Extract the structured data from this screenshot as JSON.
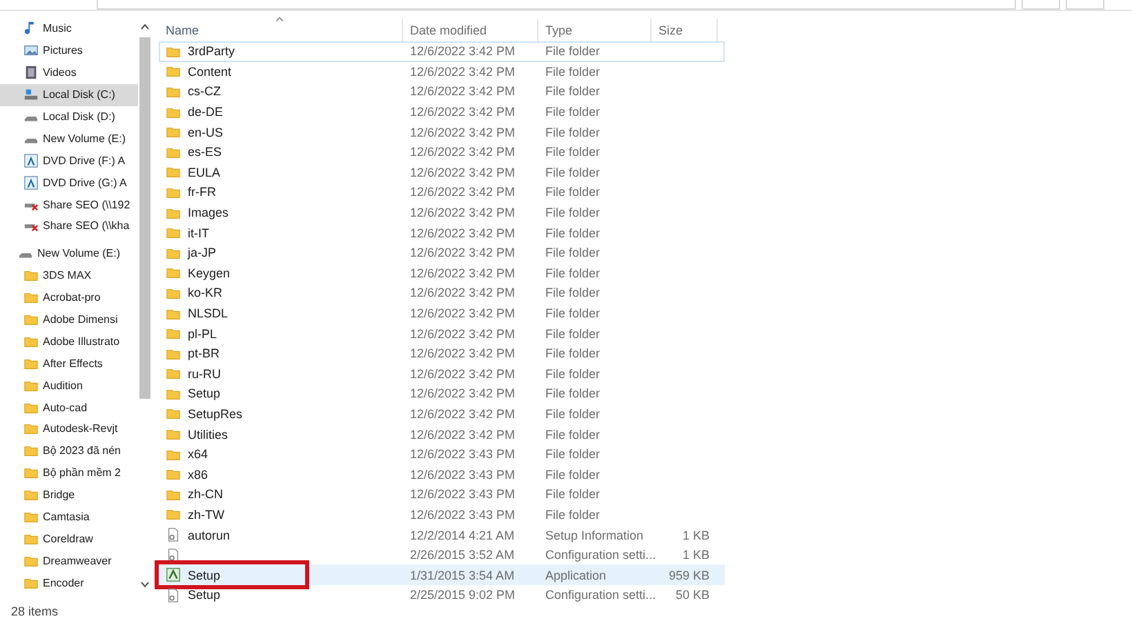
{
  "sidebar": {
    "items": [
      {
        "label": "Music",
        "kind": "music",
        "selected": false
      },
      {
        "label": "Pictures",
        "kind": "pictures",
        "selected": false
      },
      {
        "label": "Videos",
        "kind": "videos",
        "selected": false
      },
      {
        "label": "Local Disk (C:)",
        "kind": "system-drive",
        "selected": true
      },
      {
        "label": "Local Disk (D:)",
        "kind": "drive",
        "selected": false
      },
      {
        "label": "New Volume (E:)",
        "kind": "drive",
        "selected": false
      },
      {
        "label": "DVD Drive (F:) A",
        "kind": "dvd",
        "selected": false
      },
      {
        "label": "DVD Drive (G:) A",
        "kind": "dvd",
        "selected": false
      },
      {
        "label": "Share SEO (\\\\192",
        "kind": "network",
        "selected": false
      },
      {
        "label": "Share SEO (\\\\kha",
        "kind": "network",
        "selected": false
      },
      {
        "label": "New Volume (E:)",
        "kind": "drive-root",
        "selected": false,
        "children": [
          {
            "label": "3DS MAX",
            "kind": "folder",
            "selected": false
          },
          {
            "label": "Acrobat-pro",
            "kind": "folder",
            "selected": false
          },
          {
            "label": "Adobe Dimensi",
            "kind": "folder",
            "selected": false
          },
          {
            "label": "Adobe Illustrato",
            "kind": "folder",
            "selected": false
          },
          {
            "label": "After Effects",
            "kind": "folder",
            "selected": false
          },
          {
            "label": "Audition",
            "kind": "folder",
            "selected": false
          },
          {
            "label": "Auto-cad",
            "kind": "folder",
            "selected": false
          },
          {
            "label": "Autodesk-Revjt",
            "kind": "folder",
            "selected": false
          },
          {
            "label": "Bộ 2023 đã nén",
            "kind": "folder",
            "selected": false
          },
          {
            "label": "Bộ phần mềm 2",
            "kind": "folder",
            "selected": false
          },
          {
            "label": "Bridge",
            "kind": "folder",
            "selected": false
          },
          {
            "label": "Camtasia",
            "kind": "folder",
            "selected": false
          },
          {
            "label": "Coreldraw",
            "kind": "folder",
            "selected": false
          },
          {
            "label": "Dreamweaver",
            "kind": "folder",
            "selected": false
          },
          {
            "label": "Encoder",
            "kind": "folder",
            "selected": false
          }
        ]
      }
    ]
  },
  "table": {
    "columns": [
      "Name",
      "Date modified",
      "Type",
      "Size"
    ],
    "rows": [
      {
        "name": "3rdParty",
        "date": "12/6/2022 3:42 PM",
        "type": "File folder",
        "kind": "folder",
        "selected": false
      },
      {
        "name": "Content",
        "date": "12/6/2022 3:42 PM",
        "type": "File folder",
        "kind": "folder",
        "selected": false
      },
      {
        "name": "cs-CZ",
        "date": "12/6/2022 3:42 PM",
        "type": "File folder",
        "kind": "folder",
        "selected": false
      },
      {
        "name": "de-DE",
        "date": "12/6/2022 3:42 PM",
        "type": "File folder",
        "kind": "folder",
        "selected": false
      },
      {
        "name": "en-US",
        "date": "12/6/2022 3:42 PM",
        "type": "File folder",
        "kind": "folder",
        "selected": false
      },
      {
        "name": "es-ES",
        "date": "12/6/2022 3:42 PM",
        "type": "File folder",
        "kind": "folder",
        "selected": false
      },
      {
        "name": "EULA",
        "date": "12/6/2022 3:42 PM",
        "type": "File folder",
        "kind": "folder",
        "selected": false
      },
      {
        "name": "fr-FR",
        "date": "12/6/2022 3:42 PM",
        "type": "File folder",
        "kind": "folder",
        "selected": false
      },
      {
        "name": "Images",
        "date": "12/6/2022 3:42 PM",
        "type": "File folder",
        "kind": "folder",
        "selected": false
      },
      {
        "name": "it-IT",
        "date": "12/6/2022 3:42 PM",
        "type": "File folder",
        "kind": "folder",
        "selected": false
      },
      {
        "name": "ja-JP",
        "date": "12/6/2022 3:42 PM",
        "type": "File folder",
        "kind": "folder",
        "selected": false
      },
      {
        "name": "Keygen",
        "date": "12/6/2022 3:42 PM",
        "type": "File folder",
        "kind": "folder",
        "selected": false
      },
      {
        "name": "ko-KR",
        "date": "12/6/2022 3:42 PM",
        "type": "File folder",
        "kind": "folder",
        "selected": false
      },
      {
        "name": "NLSDL",
        "date": "12/6/2022 3:42 PM",
        "type": "File folder",
        "kind": "folder",
        "selected": false
      },
      {
        "name": "pl-PL",
        "date": "12/6/2022 3:42 PM",
        "type": "File folder",
        "kind": "folder",
        "selected": false
      },
      {
        "name": "pt-BR",
        "date": "12/6/2022 3:42 PM",
        "type": "File folder",
        "kind": "folder",
        "selected": false
      },
      {
        "name": "ru-RU",
        "date": "12/6/2022 3:42 PM",
        "type": "File folder",
        "kind": "folder",
        "selected": false
      },
      {
        "name": "Setup",
        "date": "12/6/2022 3:42 PM",
        "type": "File folder",
        "kind": "folder",
        "selected": false
      },
      {
        "name": "SetupRes",
        "date": "12/6/2022 3:42 PM",
        "type": "File folder",
        "kind": "folder",
        "selected": false
      },
      {
        "name": "Utilities",
        "date": "12/6/2022 3:42 PM",
        "type": "File folder",
        "kind": "folder",
        "selected": false
      },
      {
        "name": "x64",
        "date": "12/6/2022 3:43 PM",
        "type": "File folder",
        "kind": "folder",
        "selected": false
      },
      {
        "name": "x86",
        "date": "12/6/2022 3:43 PM",
        "type": "File folder",
        "kind": "folder",
        "selected": false
      },
      {
        "name": "zh-CN",
        "date": "12/6/2022 3:43 PM",
        "type": "File folder",
        "kind": "folder",
        "selected": false
      },
      {
        "name": "zh-TW",
        "date": "12/6/2022 3:43 PM",
        "type": "File folder",
        "kind": "folder",
        "selected": false
      },
      {
        "name": "autorun",
        "date": "12/2/2014 4:21 AM",
        "type": "Setup Information",
        "size": "1 KB",
        "kind": "file",
        "selected": false
      },
      {
        "date": "2/26/2015 3:52 AM",
        "type": "Configuration setti...",
        "size": "1 KB",
        "kind": "file",
        "selected": false
      },
      {
        "name": "Setup",
        "date": "1/31/2015 3:54 AM",
        "type": "Application",
        "size": "959 KB",
        "kind": "app",
        "selected": true,
        "annotated": true
      },
      {
        "name": "Setup",
        "date": "2/25/2015 9:02 PM",
        "type": "Configuration setti...",
        "size": "50 KB",
        "kind": "file",
        "selected": false
      }
    ]
  },
  "status_bar": {
    "count": "28 items"
  }
}
